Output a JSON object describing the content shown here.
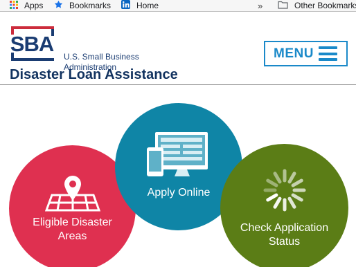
{
  "bookmarks_bar": {
    "items": [
      {
        "label": "Apps",
        "icon": "apps-grid-icon"
      },
      {
        "label": "Bookmarks",
        "icon": "star-icon"
      },
      {
        "label": "Home",
        "icon": "linkedin-icon"
      }
    ],
    "overflow": "»",
    "other_bookmarks": "Other Bookmarks"
  },
  "header": {
    "logo_text": "SBA",
    "agency_line1": "U.S. Small Business",
    "agency_line2": "Administration",
    "menu_label": "MENU"
  },
  "page": {
    "title": "Disaster Loan Assistance"
  },
  "actions": [
    {
      "label_line1": "Eligible Disaster",
      "label_line2": "Areas",
      "color": "#df3050",
      "icon": "map-pin-icon"
    },
    {
      "label_line1": "Apply Online",
      "label_line2": "",
      "color": "#0f85a6",
      "icon": "devices-icon"
    },
    {
      "label_line1": "Check Application",
      "label_line2": "Status",
      "color": "#5b7d16",
      "icon": "loading-spinner-icon"
    }
  ],
  "colors": {
    "brand_navy": "#1a3c72",
    "menu_blue": "#1a89c9",
    "title_navy": "#11325f"
  }
}
